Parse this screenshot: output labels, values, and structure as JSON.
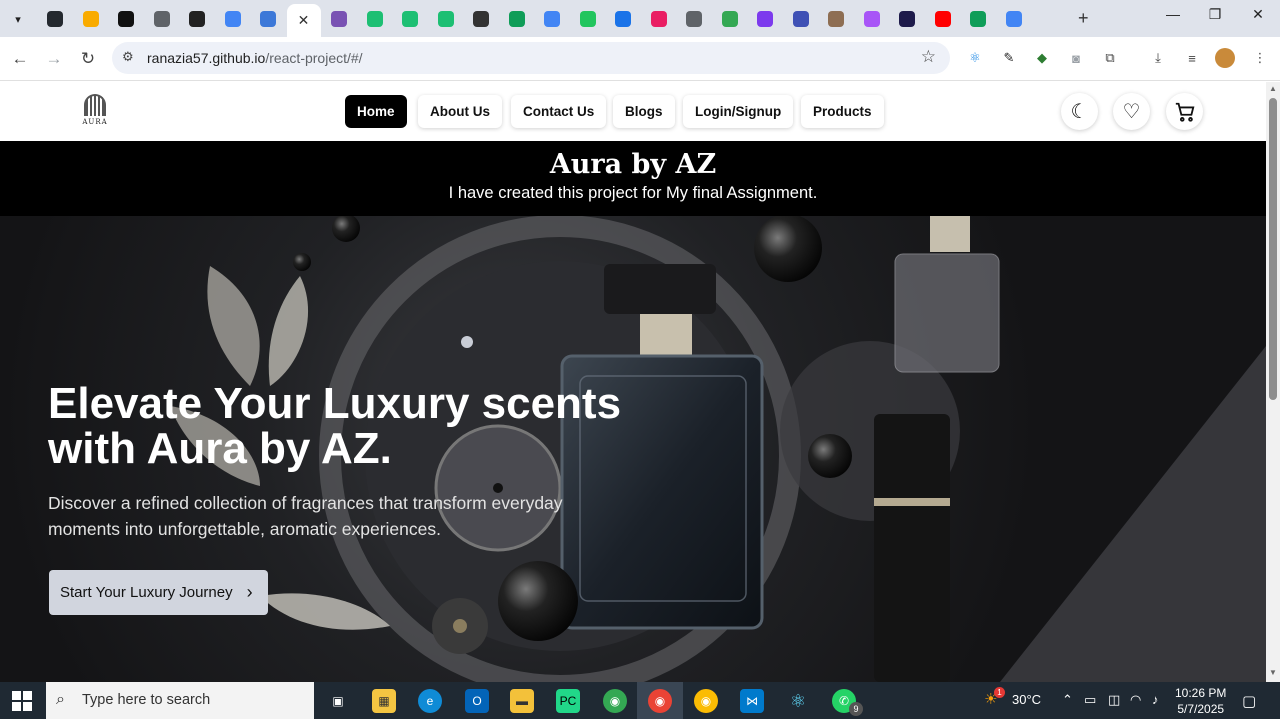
{
  "browser": {
    "tabs_menu_icon": "chevron-down-icon",
    "tab_favicons": [
      {
        "name": "github-icon",
        "color": "#24292f"
      },
      {
        "name": "analytics-icon",
        "color": "#f9ab00"
      },
      {
        "name": "threads-icon",
        "color": "#111111"
      },
      {
        "name": "cloud-icon",
        "color": "#5f6368"
      },
      {
        "name": "link-icon",
        "color": "#222222"
      },
      {
        "name": "circle-icon",
        "color": "#4285f4"
      },
      {
        "name": "vscode-web-icon",
        "color": "#3c78d8"
      },
      {
        "name": "bootstrap-icon",
        "color": "#7952b3"
      },
      {
        "name": "fiverr-icon",
        "color": "#1dbf73"
      },
      {
        "name": "fiverr-icon",
        "color": "#1dbf73"
      },
      {
        "name": "fiverr-icon",
        "color": "#1dbf73"
      },
      {
        "name": "scissors-icon",
        "color": "#333333"
      },
      {
        "name": "frame-icon",
        "color": "#0f9d58"
      },
      {
        "name": "dots-icon",
        "color": "#4285f4"
      },
      {
        "name": "slack-icon",
        "color": "#22c55e"
      },
      {
        "name": "book-icon",
        "color": "#1a73e8"
      },
      {
        "name": "dots-arc-icon",
        "color": "#e91e63"
      },
      {
        "name": "cloud-icon",
        "color": "#5f6368"
      },
      {
        "name": "play-icon",
        "color": "#34a853"
      },
      {
        "name": "check-icon",
        "color": "#7c3aed"
      },
      {
        "name": "globe-icon",
        "color": "#3f51b5"
      },
      {
        "name": "avatar-icon",
        "color": "#8e6e53"
      },
      {
        "name": "sphere-icon",
        "color": "#a855f7"
      },
      {
        "name": "ui-icon",
        "color": "#1e1b4b"
      },
      {
        "name": "youtube-icon",
        "color": "#ff0000"
      },
      {
        "name": "frame-icon",
        "color": "#0f9d58"
      },
      {
        "name": "google-icon",
        "color": "#4285f4"
      }
    ],
    "active_tab_close": "✕",
    "new_tab": "+",
    "window_controls": {
      "minimize": "—",
      "maximize": "❐",
      "close": "✕"
    },
    "url_host": "ranazia57.github.io",
    "url_path": "/react-project/#/"
  },
  "site": {
    "logo_text": "AURA",
    "nav": [
      {
        "label": "Home",
        "active": true
      },
      {
        "label": "About Us",
        "active": false
      },
      {
        "label": "Contact Us",
        "active": false
      },
      {
        "label": "Blogs",
        "active": false
      },
      {
        "label": "Login/Signup",
        "active": false
      },
      {
        "label": "Products",
        "active": false
      }
    ],
    "action_icons": [
      "moon-icon",
      "heart-icon",
      "cart-icon"
    ],
    "banner_title": "Aura by AZ",
    "banner_subtitle": "I have created this project for My final Assignment.",
    "hero_title": "Elevate Your Luxury scents with Aura by AZ.",
    "hero_subtitle": "Discover a refined collection of fragrances that transform everyday moments into unforgettable, aromatic experiences.",
    "cta_label": "Start Your Luxury Journey",
    "cta_icon": "chevron-right-icon"
  },
  "taskbar": {
    "search_placeholder": "Type here to search",
    "weather": "30°C",
    "time": "10:26 PM",
    "date": "5/7/2025",
    "whatsapp_badge": "9",
    "weather_badge": "1"
  },
  "colors": {
    "tabstrip": "#dfe3eb",
    "nav_active": "#000000",
    "banner": "#000000",
    "cta_bg": "#d1d5de",
    "taskbar": "#1f2933"
  }
}
